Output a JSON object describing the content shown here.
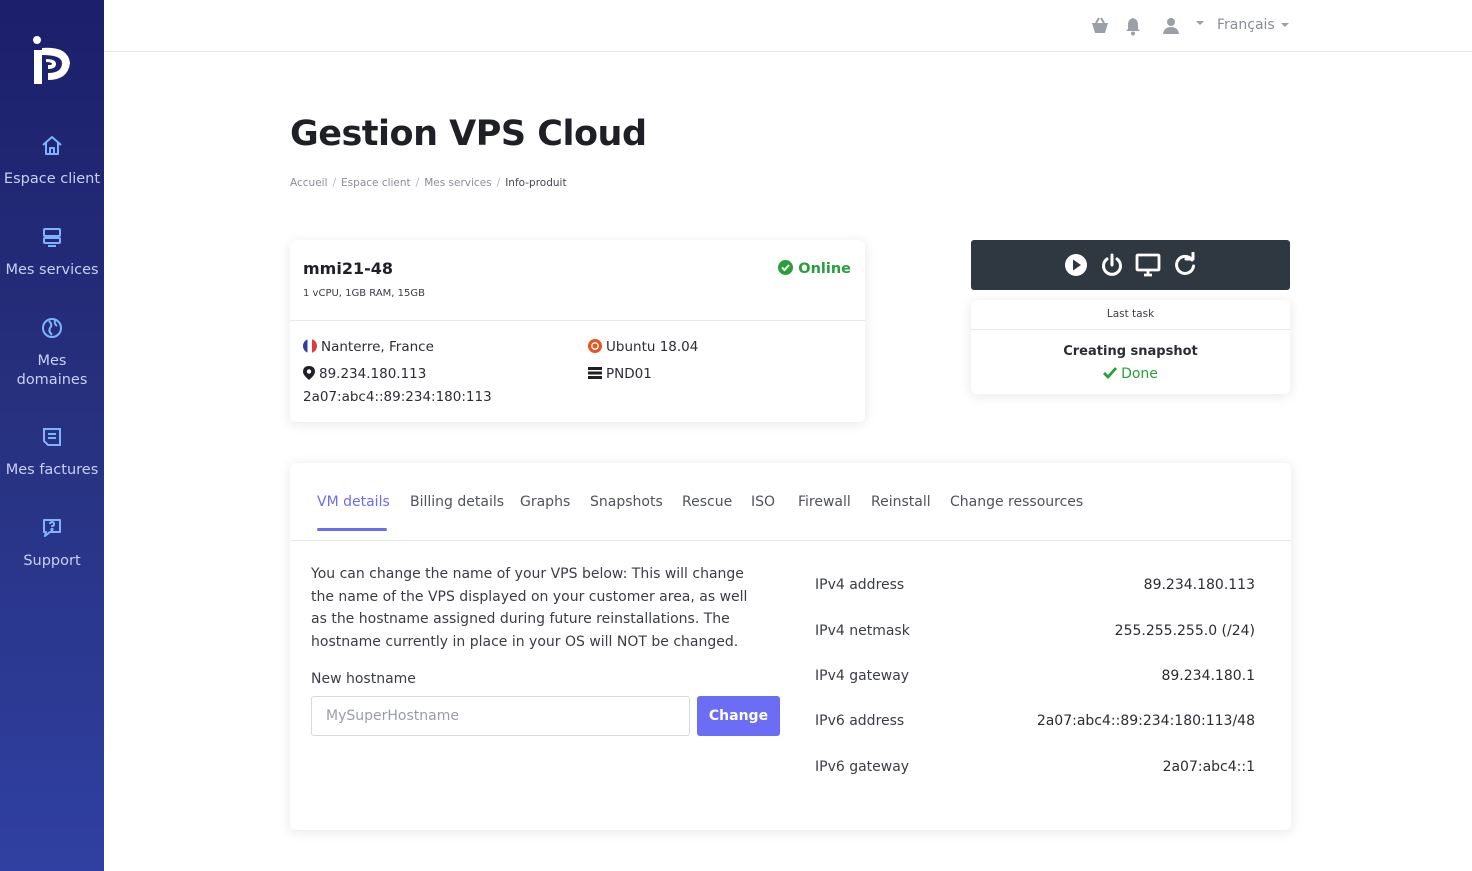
{
  "sidebar": {
    "items": [
      {
        "label": "Espace client",
        "icon": "home-icon"
      },
      {
        "label": "Mes services",
        "icon": "server-icon"
      },
      {
        "label": "Mes\ndomaines",
        "icon": "globe-icon"
      },
      {
        "label": "Mes factures",
        "icon": "invoice-icon"
      },
      {
        "label": "Support",
        "icon": "support-chat-icon"
      }
    ]
  },
  "topbar": {
    "language": "Français",
    "icons": [
      "basket-icon",
      "bell-icon",
      "user-icon"
    ]
  },
  "page": {
    "title": "Gestion VPS Cloud",
    "breadcrumb": [
      "Accueil",
      "Espace client",
      "Mes services",
      "Info-produit"
    ]
  },
  "server": {
    "name": "mmi21-48",
    "specs": "1 vCPU, 1GB RAM, 15GB",
    "status": "Online",
    "location": "Nanterre, France",
    "ipv4": "89.234.180.113",
    "ipv6": "2a07:abc4::89:234:180:113",
    "os": "Ubuntu 18.04",
    "node": "PND01"
  },
  "controls": {
    "buttons": [
      "play-icon",
      "power-icon",
      "monitor-icon",
      "restart-icon"
    ],
    "last_task_label": "Last task",
    "task_name": "Creating snapshot",
    "task_status": "Done"
  },
  "tabs": [
    "VM details",
    "Billing details",
    "Graphs",
    "Snapshots",
    "Rescue",
    "ISO",
    "Firewall",
    "Reinstall",
    "Change ressources"
  ],
  "vm_details": {
    "description": "You can change the name of your VPS below: This will change the name of the VPS displayed on your customer area, as well as the hostname assigned during future reinstallations. The hostname currently in place in your OS will NOT be changed.",
    "hostname_label": "New hostname",
    "hostname_placeholder": "MySuperHostname",
    "change_button": "Change",
    "network": [
      {
        "key": "IPv4 address",
        "value": "89.234.180.113"
      },
      {
        "key": "IPv4 netmask",
        "value": "255.255.255.0 (/24)"
      },
      {
        "key": "IPv4 gateway",
        "value": "89.234.180.1"
      },
      {
        "key": "IPv6 address",
        "value": "2a07:abc4::89:234:180:113/48"
      },
      {
        "key": "IPv6 gateway",
        "value": "2a07:abc4::1"
      }
    ]
  },
  "colors": {
    "sidebar_top": "#1c1f6b",
    "sidebar_bottom": "#3040a2",
    "accent": "#6b6ef5",
    "online": "#27a03a",
    "control_bar": "#2f3740"
  }
}
